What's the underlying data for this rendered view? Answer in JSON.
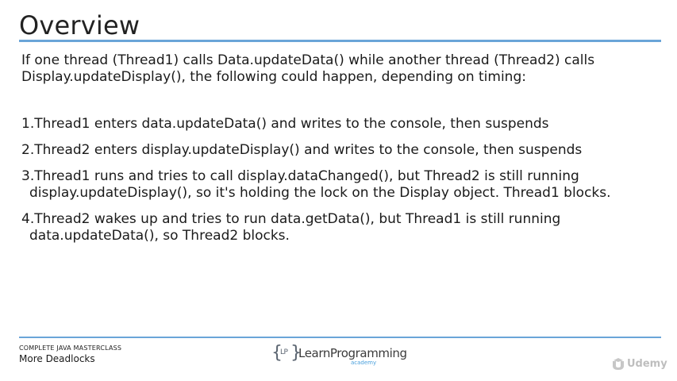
{
  "slide": {
    "title": "Overview",
    "intro": "If one thread (Thread1) calls Data.updateData() while another thread (Thread2) calls Display.updateDisplay(), the following could happen, depending on timing:",
    "steps": [
      {
        "number": "1.",
        "text": "Thread1 enters data.updateData() and writes to the console, then suspends"
      },
      {
        "number": "2.",
        "text": "Thread2 enters display.updateDisplay() and writes to the console, then suspends"
      },
      {
        "number": "3.",
        "text": "Thread1 runs and tries to call display.dataChanged(), but Thread2 is still running display.updateDisplay(), so it's holding the lock on the Display object. Thread1 blocks."
      },
      {
        "number": "4.",
        "text": "Thread2 wakes up and tries to run data.getData(), but Thread1 is still running data.updateData(), so Thread2 blocks."
      }
    ]
  },
  "footer": {
    "course": "COMPLETE JAVA MASTERCLASS",
    "lecture": "More Deadlocks",
    "logo": {
      "brace_open": "{",
      "initials": "LP",
      "brace_close": "}",
      "name": "LearnProgramming",
      "sub": "academy"
    },
    "watermark": "Udemy"
  },
  "colors": {
    "accent_rule": "#6aa5d8",
    "logo_sub": "#4aa0dc"
  }
}
